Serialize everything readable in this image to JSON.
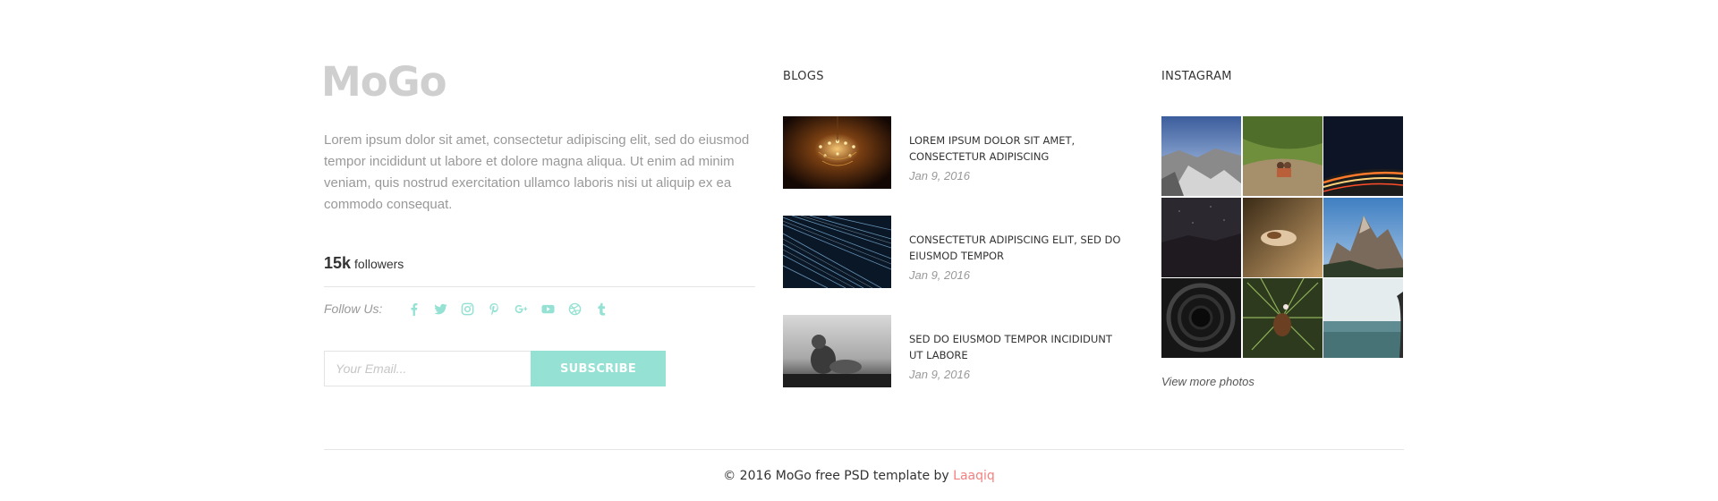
{
  "brand": {
    "logo": "MoGo"
  },
  "about": {
    "text": "Lorem ipsum dolor sit amet, consectetur adipiscing elit, sed do eiusmod tempor incididunt ut labore et dolore magna aliqua. Ut enim ad minim veniam, quis nostrud exercitation ullamco laboris nisi ut aliquip ex ea commodo consequat.",
    "followers_count": "15k",
    "followers_label": "followers",
    "follow_label": "Follow Us:",
    "social_icons": [
      "facebook-icon",
      "twitter-icon",
      "instagram-icon",
      "pinterest-icon",
      "google-plus-icon",
      "youtube-icon",
      "dribbble-icon",
      "tumblr-icon"
    ],
    "social_color": "#95e1d3"
  },
  "subscribe": {
    "placeholder": "Your Email...",
    "button_label": "SUBSCRIBE",
    "button_color": "#95e1d3"
  },
  "blogs": {
    "title": "BLOGS",
    "items": [
      {
        "title": "Lorem ipsum dolor sit amet, consectetur adipiscing",
        "date": "Jan 9, 2016"
      },
      {
        "title": "Consectetur adipiscing elit, sed do eiusmod tempor",
        "date": "Jan 9, 2016"
      },
      {
        "title": "Sed do eiusmod tempor incididunt ut labore",
        "date": "Jan 9, 2016"
      }
    ]
  },
  "instagram": {
    "title": "INSTAGRAM",
    "view_more": "View more photos"
  },
  "footer": {
    "copyright_prefix": "© 2016 MoGo free PSD template by",
    "author": "Laaqiq",
    "author_color": "#f38181"
  }
}
